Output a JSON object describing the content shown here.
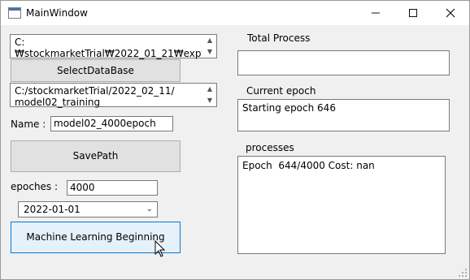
{
  "window": {
    "title": "MainWindow",
    "controls": {
      "minimize": "—",
      "maximize": "☐",
      "close": "✕"
    }
  },
  "left": {
    "database_path": "C:\n₩stockmarketTrial₩2022_01_21₩exp₩fi",
    "select_database_label": "SelectDataBase",
    "save_path": "C:/stockmarketTrial/2022_02_11/\nmodel02_training",
    "name_label": "Name :",
    "name_value": "model02_4000epoch",
    "save_path_label": "SavePath",
    "epoches_label": "epoches :",
    "epoches_value": "4000",
    "date_value": "2022-01-01",
    "start_button_label": "Machine Learning Beginning"
  },
  "right": {
    "total_process_label": "Total Process",
    "total_process_value": "",
    "current_epoch_label": "Current epoch",
    "current_epoch_value": "Starting epoch 646",
    "processes_label": "processes",
    "processes_value": "Epoch  644/4000 Cost: nan"
  }
}
